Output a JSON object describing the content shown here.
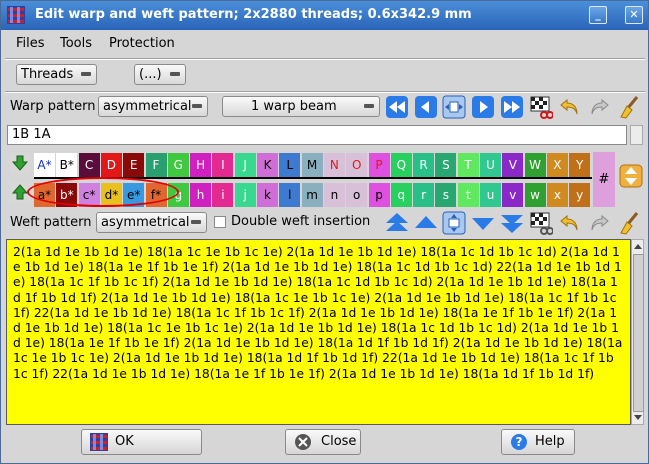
{
  "window": {
    "title": "Edit warp and weft pattern; 2x2880 threads; 0.6x342.9 mm"
  },
  "menu": [
    "Files",
    "Tools",
    "Protection"
  ],
  "toolbar": {
    "threads_combo": "Threads",
    "ellipsis_combo": "(...)"
  },
  "warp": {
    "label": "Warp pattern",
    "mode": "asymmetrical",
    "beam": "1 warp beam"
  },
  "pattern_field": "1B 1A",
  "warp_yarns": [
    {
      "l": "A*",
      "c": "#ffffff",
      "t": "#1030c0"
    },
    {
      "l": "B*",
      "c": "#ffffff",
      "t": "#000000"
    },
    {
      "l": "C",
      "c": "#5a0d3a",
      "t": "#ffffff"
    },
    {
      "l": "D",
      "c": "#e01818",
      "t": "#ffffff"
    },
    {
      "l": "E",
      "c": "#8a0a0a",
      "t": "#ffffff"
    },
    {
      "l": "F",
      "c": "#2aa070",
      "t": "#ffffff"
    },
    {
      "l": "G",
      "c": "#40c840",
      "t": "#ffffff"
    },
    {
      "l": "H",
      "c": "#d020c0",
      "t": "#ffffff"
    },
    {
      "l": "I",
      "c": "#e22a90",
      "t": "#ffffff"
    },
    {
      "l": "J",
      "c": "#38d890",
      "t": "#ffffff"
    },
    {
      "l": "K",
      "c": "#d06ed8",
      "t": "#000000"
    },
    {
      "l": "L",
      "c": "#3e7ad0",
      "t": "#000000"
    },
    {
      "l": "M",
      "c": "#8ab0c0",
      "t": "#000000"
    },
    {
      "l": "N",
      "c": "#d8c0d8",
      "t": "#e01818"
    },
    {
      "l": "O",
      "c": "#d8c0d8",
      "t": "#e01818"
    },
    {
      "l": "P",
      "c": "#e050e0",
      "t": "#e01818"
    },
    {
      "l": "Q",
      "c": "#28d060",
      "t": "#ffffff"
    },
    {
      "l": "R",
      "c": "#28c088",
      "t": "#ffffff"
    },
    {
      "l": "S",
      "c": "#28a870",
      "t": "#ffffff"
    },
    {
      "l": "T",
      "c": "#60e860",
      "t": "#ffffff"
    },
    {
      "l": "U",
      "c": "#30c890",
      "t": "#ffffff"
    },
    {
      "l": "V",
      "c": "#8a28c8",
      "t": "#ffffff"
    },
    {
      "l": "W",
      "c": "#30a030",
      "t": "#ffffff"
    },
    {
      "l": "X",
      "c": "#d08a20",
      "t": "#ffffff"
    },
    {
      "l": "Y",
      "c": "#c07018",
      "t": "#ffffff"
    }
  ],
  "weft_yarns": [
    {
      "l": "a*",
      "c": "#e06830",
      "t": "#000000"
    },
    {
      "l": "b*",
      "c": "#8a0a0a",
      "t": "#ffffff"
    },
    {
      "l": "c*",
      "c": "#d080e0",
      "t": "#000000"
    },
    {
      "l": "d*",
      "c": "#e8c020",
      "t": "#000000"
    },
    {
      "l": "e*",
      "c": "#3898e0",
      "t": "#000000"
    },
    {
      "l": "f*",
      "c": "#e06830",
      "t": "#000000"
    },
    {
      "l": "g",
      "c": "#40c840",
      "t": "#ffffff"
    },
    {
      "l": "h",
      "c": "#d020c0",
      "t": "#ffffff"
    },
    {
      "l": "i",
      "c": "#e22a90",
      "t": "#ffffff"
    },
    {
      "l": "j",
      "c": "#38d890",
      "t": "#ffffff"
    },
    {
      "l": "k",
      "c": "#d06ed8",
      "t": "#000000"
    },
    {
      "l": "l",
      "c": "#3e7ad0",
      "t": "#000000"
    },
    {
      "l": "m",
      "c": "#8ab0c0",
      "t": "#000000"
    },
    {
      "l": "n",
      "c": "#d8c0d8",
      "t": "#000000"
    },
    {
      "l": "o",
      "c": "#d8c0d8",
      "t": "#000000"
    },
    {
      "l": "p",
      "c": "#e050e0",
      "t": "#000000"
    },
    {
      "l": "q",
      "c": "#28d060",
      "t": "#ffffff"
    },
    {
      "l": "r",
      "c": "#28c088",
      "t": "#ffffff"
    },
    {
      "l": "s",
      "c": "#28a870",
      "t": "#ffffff"
    },
    {
      "l": "t",
      "c": "#60e860",
      "t": "#ffffff"
    },
    {
      "l": "u",
      "c": "#30c890",
      "t": "#ffffff"
    },
    {
      "l": "v",
      "c": "#8a28c8",
      "t": "#ffffff"
    },
    {
      "l": "w",
      "c": "#30a030",
      "t": "#ffffff"
    },
    {
      "l": "x",
      "c": "#d08a20",
      "t": "#ffffff"
    },
    {
      "l": "y",
      "c": "#c07018",
      "t": "#ffffff"
    }
  ],
  "hash_label": "#",
  "weft": {
    "label": "Weft pattern",
    "mode": "asymmetrical",
    "double_insertion": "Double weft insertion"
  },
  "pattern_text": "2(1a 1d 1e 1b 1d 1e) 18(1a 1c 1e 1b 1c 1e) 2(1a 1d 1e 1b 1d 1e) 18(1a 1c 1d 1b 1c 1d) 2(1a 1d 1e 1b 1d 1e) 18(1a 1e 1f 1b 1e 1f) 2(1a 1d 1e 1b 1d 1e) 18(1a 1c 1d 1b 1c 1d) 22(1a 1d 1e 1b 1d 1e) 18(1a 1c 1f 1b 1c 1f) 2(1a 1d 1e 1b 1d 1e) 18(1a 1c 1d 1b 1c 1d) 2(1a 1d 1e 1b 1d 1e) 18(1a 1d 1f 1b 1d 1f) 2(1a 1d 1e 1b 1d 1e) 18(1a 1c 1e 1b 1c 1e) 2(1a 1d 1e 1b 1d 1e) 18(1a 1c 1f 1b 1c 1f) 22(1a 1d 1e 1b 1d 1e) 18(1a 1c 1f 1b 1c 1f) 2(1a 1d 1e 1b 1d 1e) 18(1a 1e 1f 1b 1e 1f) 2(1a 1d 1e 1b 1d 1e) 18(1a 1c 1e 1b 1c 1e) 2(1a 1d 1e 1b 1d 1e) 18(1a 1c 1d 1b 1c 1d) 2(1a 1d 1e 1b 1d 1e) 18(1a 1e 1f 1b 1e 1f) 2(1a 1d 1e 1b 1d 1e) 18(1a 1d 1f 1b 1d 1f) 2(1a 1d 1e 1b 1d 1e) 18(1a 1c 1e 1b 1c 1e) 2(1a 1d 1e 1b 1d 1e) 18(1a 1d 1f 1b 1d 1f) 22(1a 1d 1e 1b 1d 1e) 18(1a 1c 1f 1b 1c 1f) 22(1a 1d 1e 1b 1d 1e) 18(1a 1e 1f 1b 1e 1f) 2(1a 1d 1e 1b 1d 1e) 18(1a 1d 1f 1b 1d 1f)",
  "buttons": {
    "ok": "OK",
    "close": "Close",
    "help": "Help"
  },
  "icons": {
    "title": "weave-icon",
    "ok": "weave-icon",
    "close": "close-icon",
    "help": "help-icon"
  }
}
